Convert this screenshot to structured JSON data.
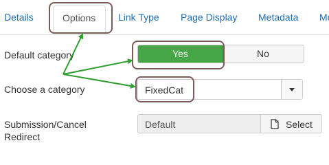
{
  "tabs": [
    {
      "label": "Details"
    },
    {
      "label": "Options"
    },
    {
      "label": "Link Type"
    },
    {
      "label": "Page Display"
    },
    {
      "label": "Metadata"
    },
    {
      "label": "Mo"
    }
  ],
  "form": {
    "default_category": {
      "label": "Default category",
      "yes": "Yes",
      "no": "No"
    },
    "choose_category": {
      "label": "Choose a category",
      "value": "FixedCat"
    },
    "redirect": {
      "label_line1": "Submission/Cancel",
      "label_line2": "Redirect",
      "value": "Default",
      "button": "Select"
    }
  },
  "colors": {
    "accent_green": "#46a546",
    "annotation_arrow": "#2e9e2e",
    "annotation_box": "#7b5a5a",
    "link_blue": "#1f6fb5"
  }
}
